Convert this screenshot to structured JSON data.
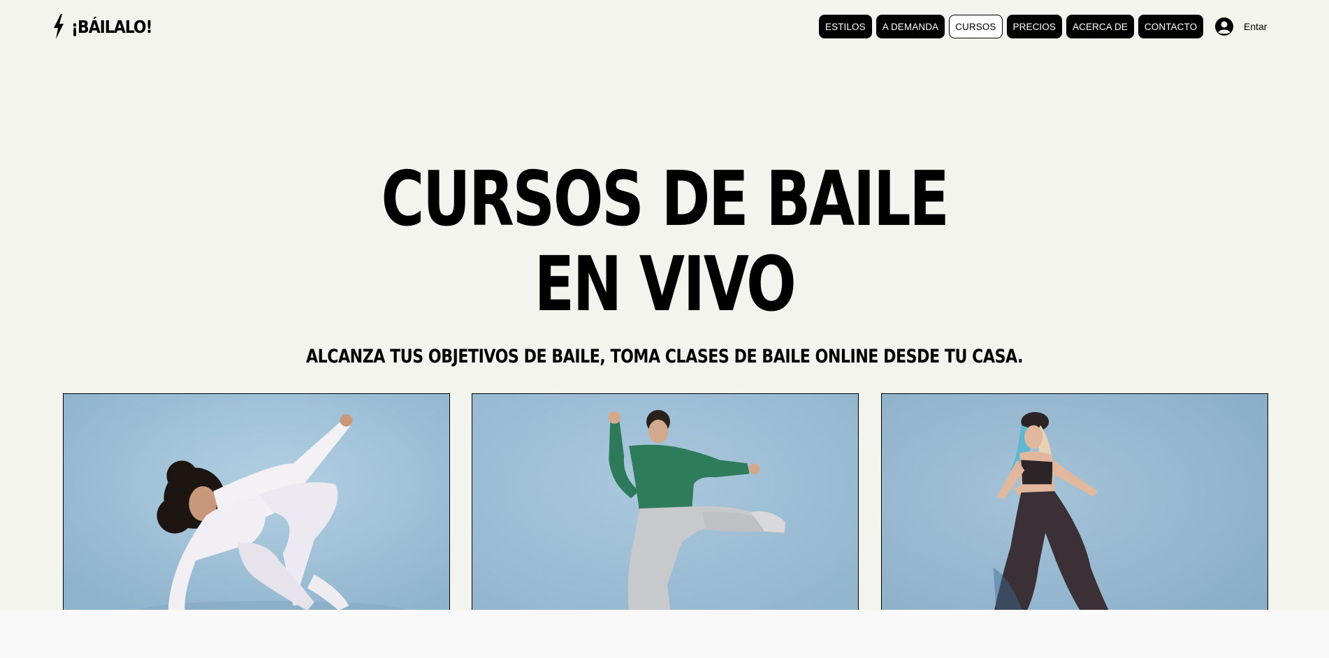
{
  "header": {
    "logo_text": "¡BÁILALO!",
    "logo_icon": "lightning-bolt-icon",
    "nav": [
      {
        "label": "ESTILOS",
        "active": false
      },
      {
        "label": "A DEMANDA",
        "active": false
      },
      {
        "label": "CURSOS",
        "active": true
      },
      {
        "label": "PRECIOS",
        "active": false
      },
      {
        "label": "ACERCA DE",
        "active": false
      },
      {
        "label": "CONTACTO",
        "active": false
      }
    ],
    "login_label": "Entar",
    "login_icon": "user-avatar-icon"
  },
  "hero": {
    "title_line1": "CURSOS DE BAILE",
    "title_line2": "EN VIVO",
    "subtitle": "ALCANZA TUS OBJETIVOS DE BAILE, TOMA CLASES DE BAILE ONLINE DESDE TU CASA."
  },
  "cards": [
    {
      "image": "dancer-white-outfit-photo"
    },
    {
      "image": "dancer-green-sweatshirt-photo"
    },
    {
      "image": "dancer-dark-outfit-photo"
    }
  ],
  "colors": {
    "background": "#f4f4ef",
    "text": "#000000",
    "nav_bg": "#000000",
    "nav_active_bg": "#ffffff",
    "photo_bg": "#9ec0d7"
  }
}
